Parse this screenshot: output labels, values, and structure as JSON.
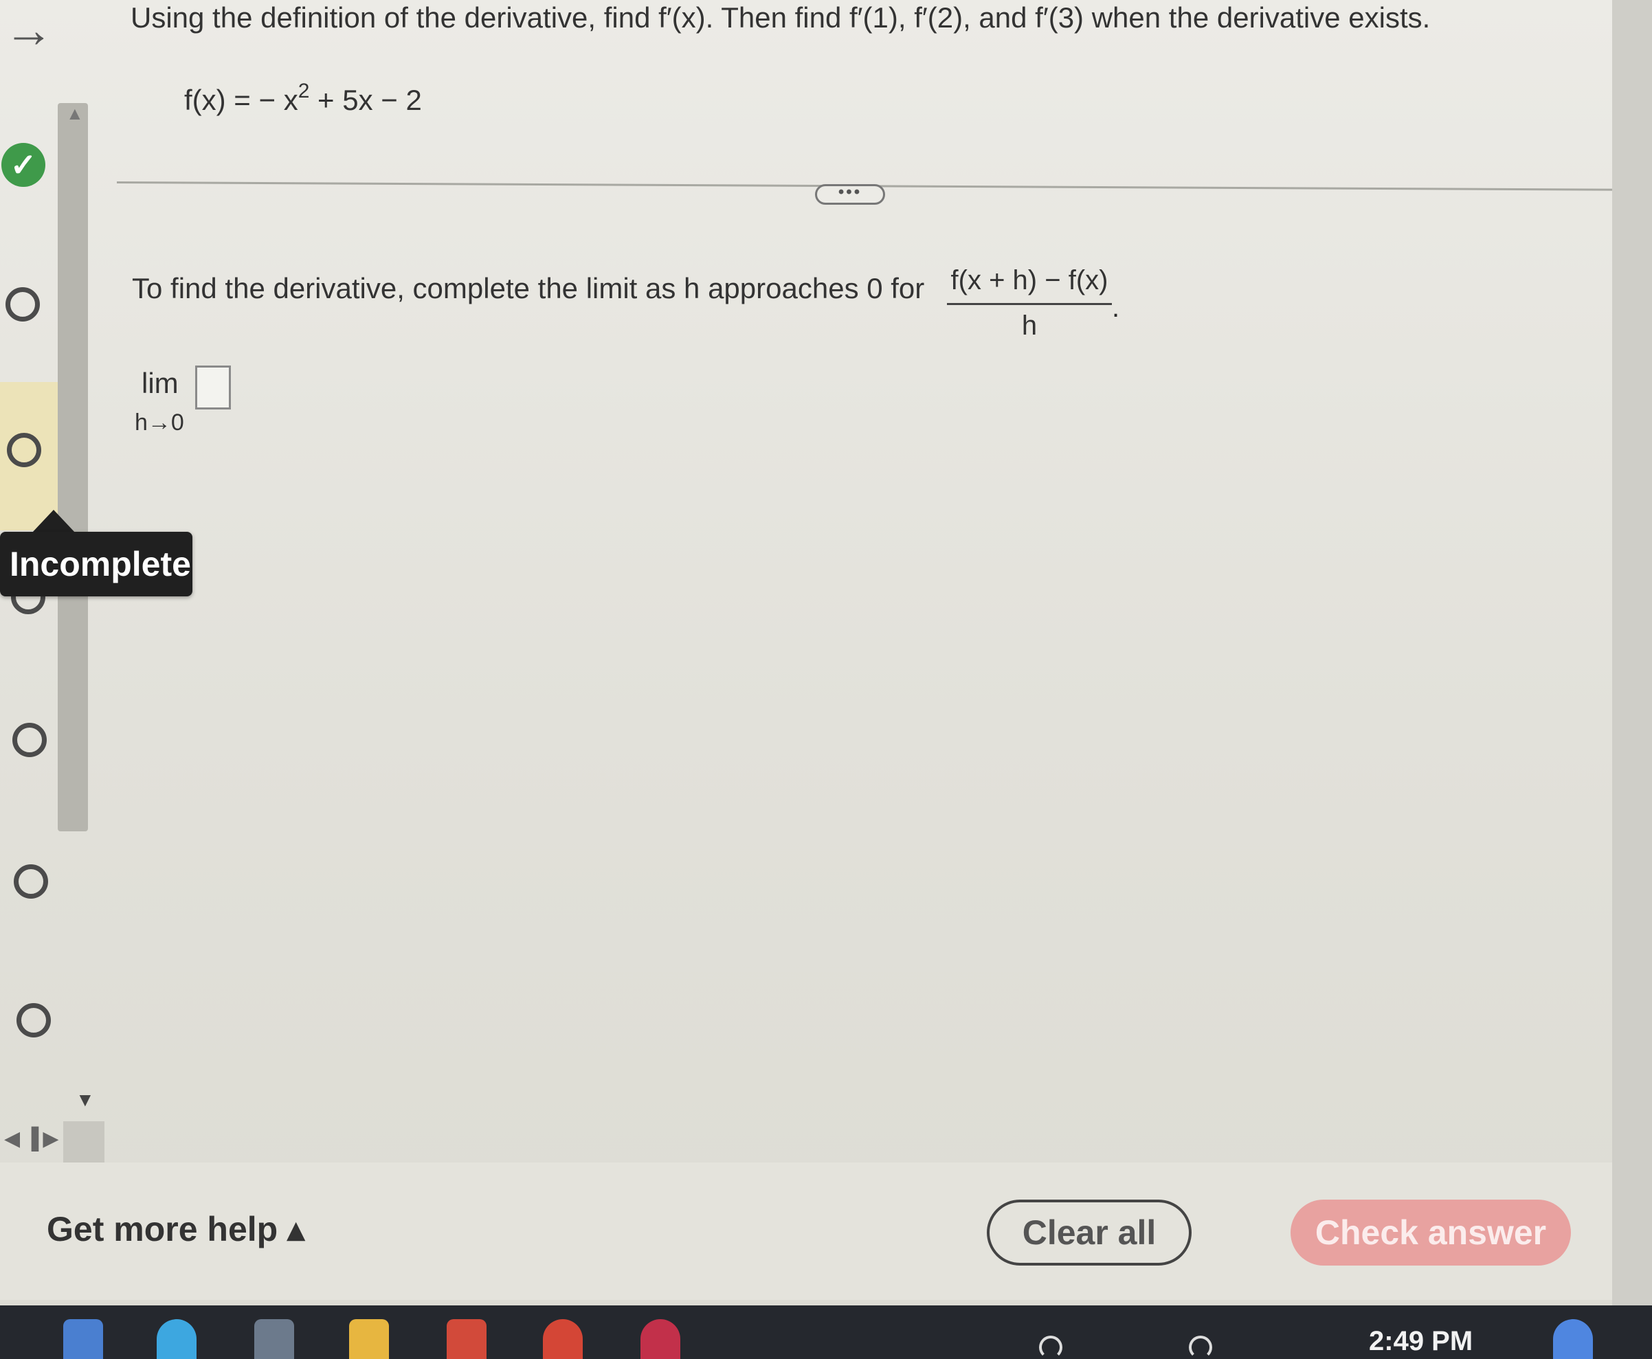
{
  "question": {
    "prompt": "Using the definition of the derivative, find f′(x). Then find f′(1), f′(2), and f′(3) when the derivative exists.",
    "function_lhs": "f(x) = − x",
    "function_exp": "2",
    "function_rhs": " + 5x − 2",
    "more_button": "•••",
    "instruction": "To find the derivative, complete the limit as h approaches 0 for",
    "fraction_numerator": "f(x + h) − f(x)",
    "fraction_denominator": "h",
    "fraction_end": ".",
    "limit_word": "lim",
    "limit_sub": "h→0",
    "answer_value": ""
  },
  "nav": {
    "back_arrow": "→",
    "check_mark": "✓",
    "tooltip": "Incomplete",
    "scroll_up": "▲",
    "scroll_down": "▼",
    "prev_next": "◀▐▶"
  },
  "footer": {
    "get_help": "Get more help ▴",
    "clear_all": "Clear all",
    "check_answer": "Check answer"
  },
  "taskbar": {
    "clock": "2:49 PM"
  },
  "colors": {
    "check_green": "#3f9a4a",
    "check_answer_bg": "#e8a2a0",
    "tooltip_bg": "#202020",
    "highlight_yellow": "#ece3b8"
  }
}
